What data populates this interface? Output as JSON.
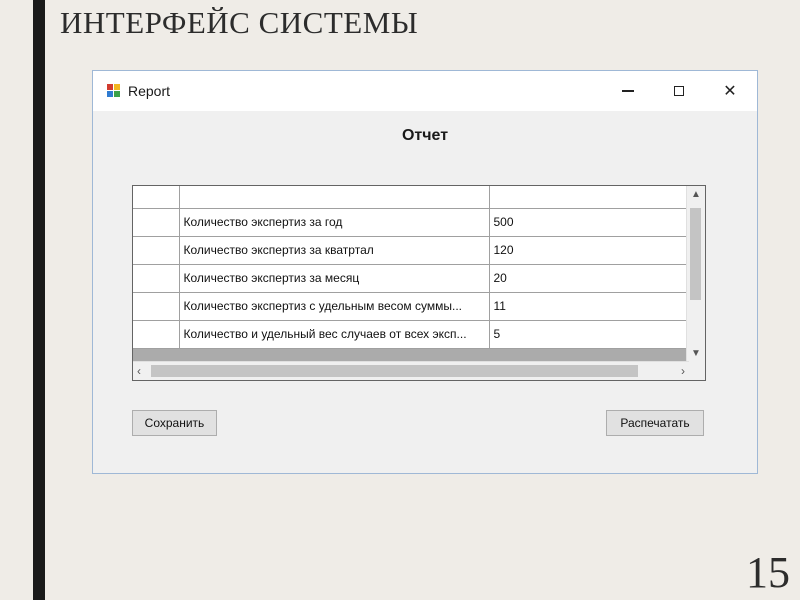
{
  "slide": {
    "title": "ИНТЕРФЕЙС СИСТЕМЫ",
    "page_number": "15"
  },
  "window": {
    "title": "Report",
    "icon": "app-icon",
    "controls": [
      "minimize-icon",
      "maximize-icon",
      "close-icon"
    ],
    "close_glyph": "✕"
  },
  "report": {
    "heading": "Отчет",
    "columns": [
      "",
      "",
      ""
    ],
    "rows": [
      {
        "label": "Количество экспертиз за год",
        "value": "500"
      },
      {
        "label": "Количество экспертиз за кватртал",
        "value": "120"
      },
      {
        "label": "Количество экспертиз за месяц",
        "value": "20"
      },
      {
        "label": "Количество экспертиз с удельным весом суммы...",
        "value": "11"
      },
      {
        "label": "Количество и удельный вес случаев от всех эксп...",
        "value": "5"
      }
    ]
  },
  "buttons": {
    "save": "Сохранить",
    "print": "Распечатать"
  }
}
